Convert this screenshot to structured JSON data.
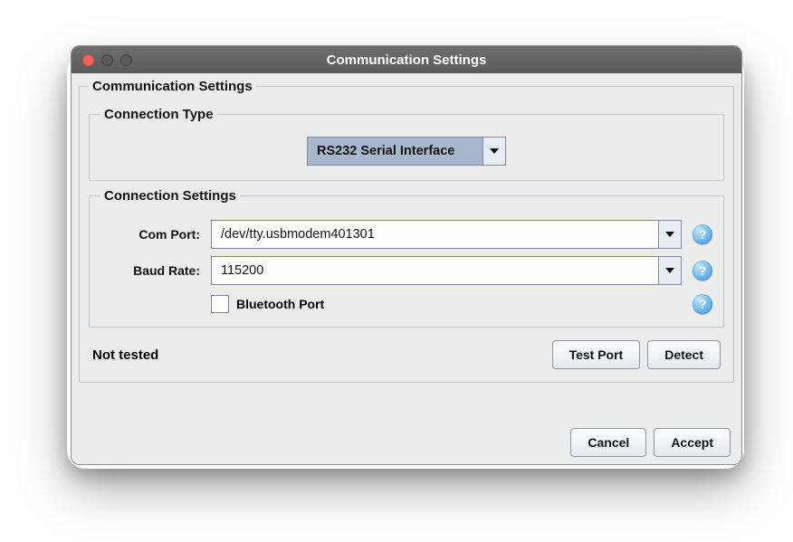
{
  "window": {
    "title": "Communication Settings"
  },
  "group": {
    "title": "Communication Settings",
    "connection_type": {
      "title": "Connection Type",
      "selected": "RS232 Serial Interface"
    },
    "connection_settings": {
      "title": "Connection Settings",
      "com_port_label": "Com Port:",
      "com_port_value": "/dev/tty.usbmodem401301",
      "baud_rate_label": "Baud Rate:",
      "baud_rate_value": "115200",
      "bluetooth_label": "Bluetooth Port"
    },
    "status": "Not tested",
    "buttons": {
      "test_port": "Test Port",
      "detect": "Detect"
    }
  },
  "footer": {
    "cancel": "Cancel",
    "accept": "Accept"
  }
}
